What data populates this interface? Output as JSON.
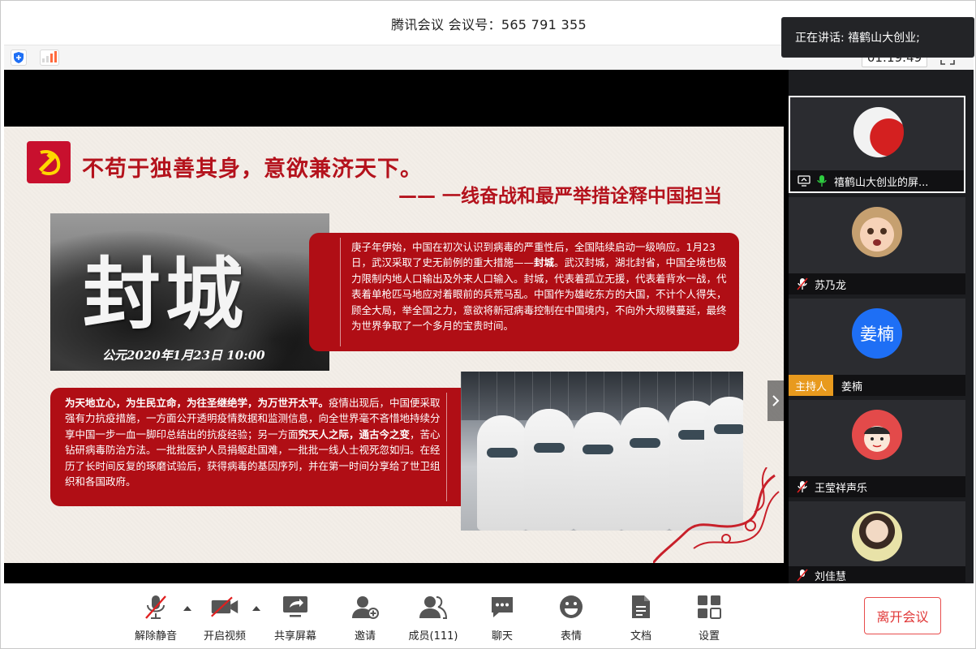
{
  "window": {
    "title": "腾讯会议 会议号：565 791 355"
  },
  "infobar": {
    "timer": "01:19:49"
  },
  "slide": {
    "heading1": "不苟于独善其身，意欲兼济天下。",
    "heading2": "—— 一线奋战和最严举措诠释中国担当",
    "image_big_text": "封城",
    "image_date": "公元2020年1月23日 10:00",
    "box1_text_a": "庚子年伊始，中国在初次认识到病毒的严重性后，全国陆续启动一级响应。1月23日，武汉采取了史无前例的重大措施——",
    "box1_text_bold": "封城",
    "box1_text_b": "。武汉封城，湖北封省，中国全境也极力限制内地人口输出及外来人口输入。封城，代表着孤立无援，代表着背水一战，代表着单枪匹马地应对着眼前的兵荒马乱。中国作为雄屹东方的大国，不计个人得失，顾全大局，举全国之力，意欲将新冠病毒控制在中国境内，不向外大规模蔓延，最终为世界争取了一个多月的宝贵时间。",
    "box2_text_bold1": "为天地立心，为生民立命，为往圣继绝学，为万世开太平。",
    "box2_text_a": "疫情出现后，中国便采取强有力抗疫措施，一方面公开透明疫情数据和监测信息，向全世界毫不吝惜地持续分享中国一步一血一脚印总结出的抗疫经验；另一方面",
    "box2_text_bold2": "究天人之际，通古今之变",
    "box2_text_b": "，苦心钻研病毒防治方法。一批批医护人员捐躯赴国难，一批批一线人士视死忽如归。在经历了长时间反复的琢磨试验后，获得病毒的基因序列，并在第一时间分享给了世卫组织和各国政府。"
  },
  "panel": {
    "speaking": "正在讲话: 禧鹤山大创业;",
    "participants": [
      {
        "name": "禧鹤山大创业的屏...",
        "role": ""
      },
      {
        "name": "苏乃龙",
        "role": ""
      },
      {
        "name": "姜楠",
        "role": "主持人",
        "avatar_text": "姜楠"
      },
      {
        "name": "王莹祥声乐",
        "role": ""
      },
      {
        "name": "刘佳慧",
        "role": ""
      }
    ]
  },
  "toolbar": {
    "unmute": "解除静音",
    "start_video": "开启视频",
    "share_screen": "共享屏幕",
    "invite": "邀请",
    "members": "成员(111)",
    "chat": "聊天",
    "emoji": "表情",
    "docs": "文档",
    "settings": "设置",
    "leave": "离开会议"
  },
  "colors": {
    "brand_red": "#b00e15",
    "host_badge": "#e89a1e",
    "avatar_blue": "#1e6ff5",
    "leave_red": "#e03636"
  }
}
